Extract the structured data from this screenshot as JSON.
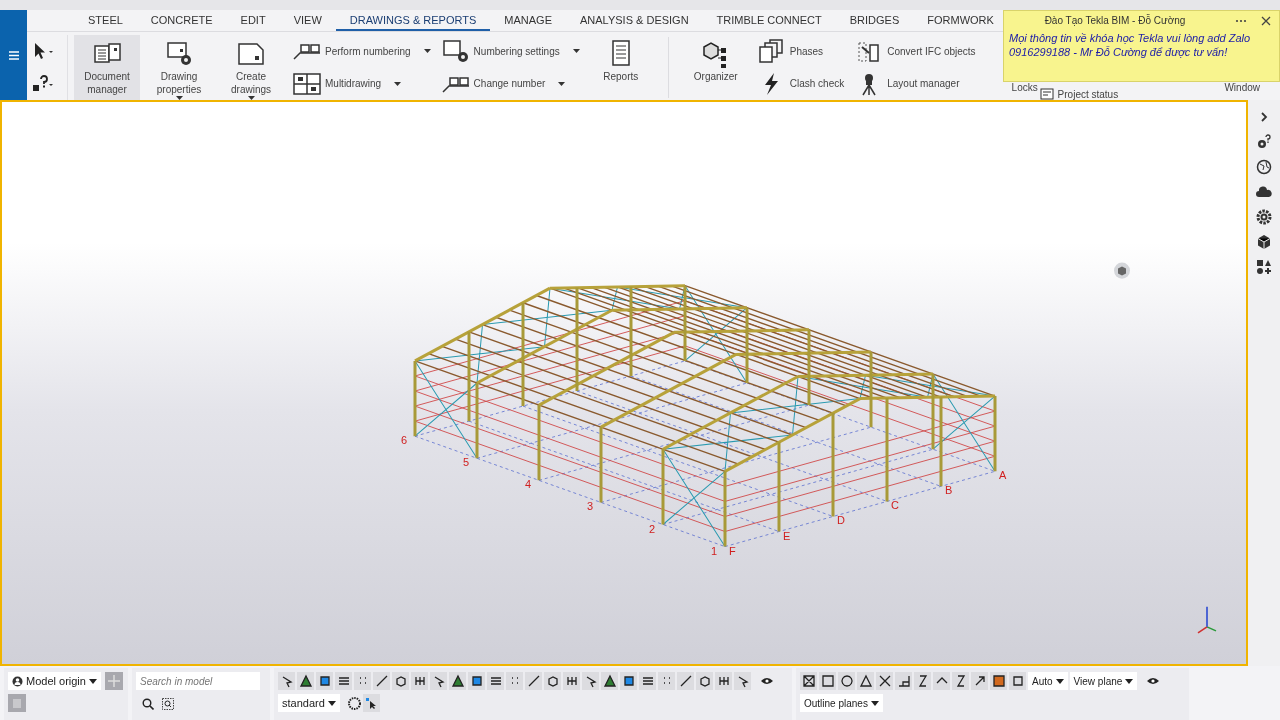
{
  "tabs": [
    {
      "label": "STEEL",
      "selected": false
    },
    {
      "label": "CONCRETE",
      "selected": false
    },
    {
      "label": "EDIT",
      "selected": false
    },
    {
      "label": "VIEW",
      "selected": false
    },
    {
      "label": "DRAWINGS & REPORTS",
      "selected": true
    },
    {
      "label": "MANAGE",
      "selected": false
    },
    {
      "label": "ANALYSIS & DESIGN",
      "selected": false
    },
    {
      "label": "TRIMBLE CONNECT",
      "selected": false
    },
    {
      "label": "BRIDGES",
      "selected": false
    },
    {
      "label": "FORMWORK",
      "selected": false
    }
  ],
  "ribbon": [
    {
      "kind": "big",
      "label": "Document manager",
      "highlighted": true,
      "dropdown": false
    },
    {
      "kind": "big",
      "label": "Drawing properties",
      "highlighted": false,
      "dropdown": true
    },
    {
      "kind": "big",
      "label": "Create drawings",
      "highlighted": false,
      "dropdown": true
    },
    {
      "kind": "pair",
      "items": [
        {
          "label": "Perform numbering",
          "dropdown": true
        },
        {
          "label": "Multidrawing",
          "dropdown": true
        }
      ]
    },
    {
      "kind": "pair",
      "items": [
        {
          "label": "Numbering settings",
          "dropdown": true
        },
        {
          "label": "Change number",
          "dropdown": true
        }
      ]
    },
    {
      "kind": "big",
      "label": "Reports",
      "highlighted": false,
      "dropdown": false
    },
    {
      "kind": "divider"
    },
    {
      "kind": "big",
      "label": "Organizer",
      "highlighted": false,
      "dropdown": false
    },
    {
      "kind": "pair",
      "items": [
        {
          "label": "Phases",
          "dropdown": false
        },
        {
          "label": "Clash check",
          "dropdown": false
        }
      ]
    },
    {
      "kind": "pair",
      "items": [
        {
          "label": "Convert IFC objects",
          "dropdown": false
        },
        {
          "label": "Layout manager",
          "dropdown": false
        }
      ]
    }
  ],
  "ribbon_hidden": {
    "locks": "Locks",
    "project_status": "Project status",
    "window": "Window"
  },
  "notification": {
    "title": "Đào Tạo Tekla BIM - Đỗ Cường",
    "message": "Mọi thông tin về khóa học Tekla vui lòng add Zalo 0916299188 - Mr Đỗ Cường để được tư vấn!"
  },
  "grid_labels": {
    "numbers": [
      "1",
      "2",
      "3",
      "4",
      "5",
      "6"
    ],
    "letters": [
      "A",
      "B",
      "C",
      "D",
      "E",
      "F"
    ]
  },
  "bottom": {
    "origin": "Model origin",
    "search": {
      "placeholder": "Search in model"
    },
    "filter": "standard",
    "auto": "Auto",
    "view_plane": "View plane",
    "outline": "Outline planes"
  }
}
